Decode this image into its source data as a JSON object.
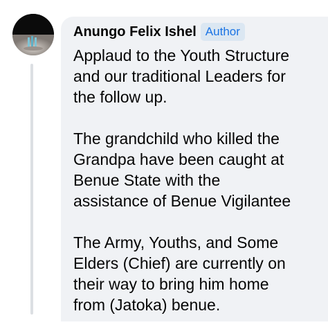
{
  "comment": {
    "author_name": "Anungo Felix Ishel",
    "author_badge": "Author",
    "paragraphs": [
      "Applaud to the Youth Structure\nand our traditional Leaders for\nthe follow up.",
      "The grandchild who killed the\nGrandpa have been caught at\nBenue State with the\nassistance of Benue Vigilantee",
      "The Army, Youths, and Some\nElders (Chief) are currently on\ntheir way to bring him home\nfrom (Jatoka) benue."
    ]
  },
  "colors": {
    "bubble_bg": "#f0f2f5",
    "badge_bg": "#dbe7f2",
    "badge_text": "#1b74e4",
    "text": "#050505",
    "thread_line": "#dcdfe3"
  },
  "icons": {
    "avatar": "user-avatar-photo"
  }
}
